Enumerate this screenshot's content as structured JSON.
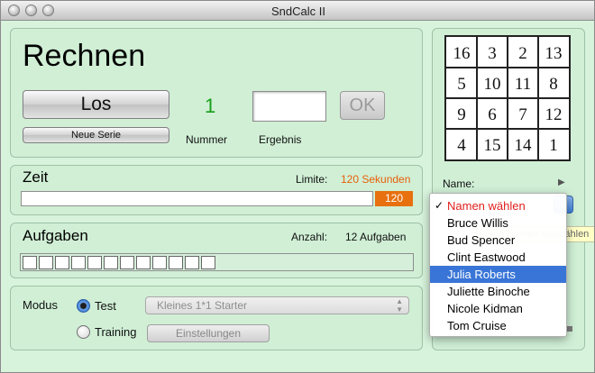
{
  "window": {
    "title": "SndCalc II"
  },
  "rechnen": {
    "title": "Rechnen",
    "los_label": "Los",
    "neue_serie_label": "Neue Serie",
    "nummer_value": "1",
    "nummer_label": "Nummer",
    "ergebnis_label": "Ergebnis",
    "ergebnis_value": "",
    "ok_label": "OK"
  },
  "zeit": {
    "title": "Zeit",
    "limit_label": "Limite:",
    "limit_value": "120 Sekunden",
    "remaining": "120",
    "progress_fraction": 1.0
  },
  "aufgaben": {
    "title": "Aufgaben",
    "anzahl_label": "Anzahl:",
    "anzahl_value": "12 Aufgaben",
    "task_count": 12
  },
  "modus": {
    "label": "Modus",
    "test_label": "Test",
    "training_label": "Training",
    "selected": "test",
    "level_select": "Kleines 1*1 Starter",
    "einstellungen_label": "Einstellungen"
  },
  "puzzle": {
    "numbers": [
      [
        "16",
        "3",
        "2",
        "13"
      ],
      [
        "5",
        "10",
        "11",
        "8"
      ],
      [
        "9",
        "6",
        "7",
        "12"
      ],
      [
        "4",
        "15",
        "14",
        "1"
      ]
    ]
  },
  "name": {
    "label": "Name:",
    "tooltip": "Einen Namen auswählen",
    "menu": [
      {
        "label": "Namen wählen",
        "checked": true,
        "red": true,
        "selected": false
      },
      {
        "label": "Bruce Willis",
        "checked": false,
        "red": false,
        "selected": false
      },
      {
        "label": "Bud Spencer",
        "checked": false,
        "red": false,
        "selected": false
      },
      {
        "label": "Clint Eastwood",
        "checked": false,
        "red": false,
        "selected": false
      },
      {
        "label": "Julia Roberts",
        "checked": false,
        "red": false,
        "selected": true
      },
      {
        "label": "Juliette Binoche",
        "checked": false,
        "red": false,
        "selected": false
      },
      {
        "label": "Nicole Kidman",
        "checked": false,
        "red": false,
        "selected": false
      },
      {
        "label": "Tom Cruise",
        "checked": false,
        "red": false,
        "selected": false
      }
    ]
  },
  "colors": {
    "accent_orange": "#e8700f",
    "nummer_green": "#1a9e1a",
    "menu_highlight": "#3875d7",
    "window_bg": "#d7f3dc"
  }
}
